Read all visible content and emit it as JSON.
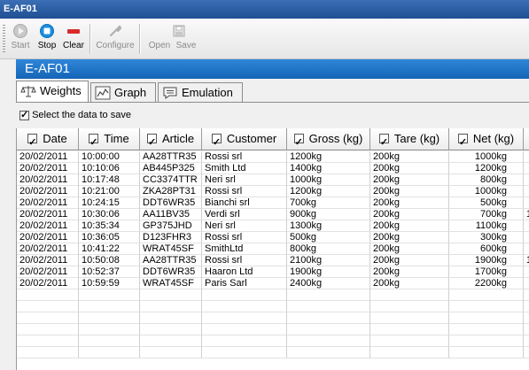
{
  "window": {
    "title": "E-AF01"
  },
  "toolbar": {
    "start": "Start",
    "stop": "Stop",
    "clear": "Clear",
    "configure": "Configure",
    "open": "Open",
    "save": "Save"
  },
  "header": {
    "title": "E-AF01"
  },
  "tabs": [
    {
      "label": "Weights",
      "icon": "scale-icon"
    },
    {
      "label": "Graph",
      "icon": "graph-icon"
    },
    {
      "label": "Emulation",
      "icon": "speech-bubble-icon"
    }
  ],
  "save_option": {
    "label": "Select the data to save",
    "checked": true
  },
  "table": {
    "columns": [
      "Date",
      "Time",
      "Article",
      "Customer",
      "Gross (kg)",
      "Tare (kg)",
      "Net (kg)"
    ],
    "rows": [
      [
        "20/02/2011",
        "10:00:00",
        "AA28TTR35",
        "Rossi srl",
        "1200kg",
        "200kg",
        "1000kg",
        ""
      ],
      [
        "20/02/2011",
        "10:10:06",
        "AB445P325",
        "Smith Ltd",
        "1400kg",
        "200kg",
        "1200kg",
        ""
      ],
      [
        "20/02/2011",
        "10:17:48",
        "CC3374TTR",
        "Neri srl",
        "1000kg",
        "200kg",
        "800kg",
        ""
      ],
      [
        "20/02/2011",
        "10:21:00",
        "ZKA28PT31",
        "Rossi srl",
        "1200kg",
        "200kg",
        "1000kg",
        ""
      ],
      [
        "20/02/2011",
        "10:24:15",
        "DDT6WR35",
        "Bianchi srl",
        "700kg",
        "200kg",
        "500kg",
        ""
      ],
      [
        "20/02/2011",
        "10:30:06",
        "AA11BV35",
        "Verdi srl",
        "900kg",
        "200kg",
        "700kg",
        "1"
      ],
      [
        "20/02/2011",
        "10:35:34",
        "GP375JHD",
        "Neri srl",
        "1300kg",
        "200kg",
        "1100kg",
        ""
      ],
      [
        "20/02/2011",
        "10:36:05",
        "D123FHR3",
        "Rossi srl",
        "500kg",
        "200kg",
        "300kg",
        ""
      ],
      [
        "20/02/2011",
        "10:41:22",
        "WRAT45SF",
        "SmithLtd",
        "800kg",
        "200kg",
        "600kg",
        ""
      ],
      [
        "20/02/2011",
        "10:50:08",
        "AA28TTR35",
        "Rossi srl",
        "2100kg",
        "200kg",
        "1900kg",
        "1"
      ],
      [
        "20/02/2011",
        "10:52:37",
        "DDT6WR35",
        "Haaron Ltd",
        "1900kg",
        "200kg",
        "1700kg",
        ""
      ],
      [
        "20/02/2011",
        "10:59:59",
        "WRAT45SF",
        "Paris Sarl",
        "2400kg",
        "200kg",
        "2200kg",
        ""
      ]
    ]
  },
  "colors": {
    "title_bar": "#1f4f93",
    "header_bar": "#1f78cc",
    "stop_blue": "#1a8fe0",
    "clear_red": "#d92a2a"
  }
}
